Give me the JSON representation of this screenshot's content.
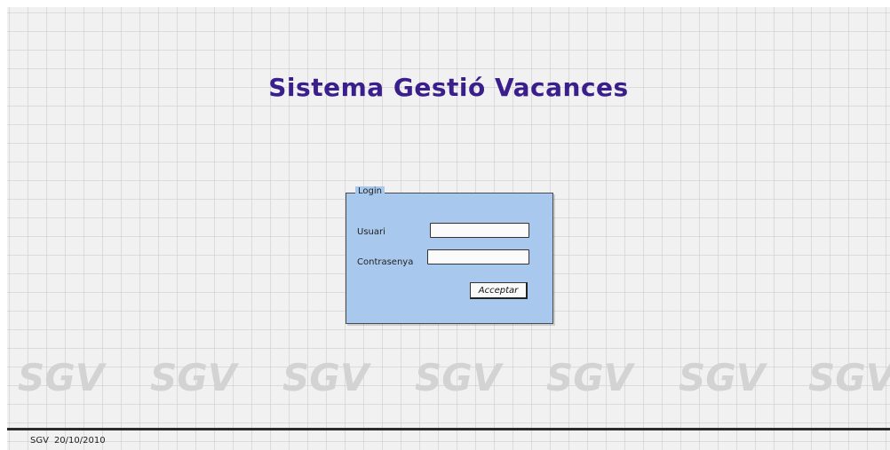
{
  "app": {
    "title": "Sistema Gestió Vacances"
  },
  "login": {
    "legend": "Login",
    "user_label": "Usuari",
    "user_value": "",
    "password_label": "Contrasenya",
    "password_value": "",
    "accept_label": "Acceptar"
  },
  "watermark": {
    "items": [
      "SGV",
      "SGV",
      "SGV",
      "SGV",
      "SGV",
      "SGV",
      "SGV"
    ]
  },
  "footer": {
    "app_code": "SGV",
    "date": "20/10/2010"
  },
  "colors": {
    "title": "#3a1e8c",
    "login_panel": "#a9c8ee",
    "watermark": "#d3d3d3",
    "background": "#f1f1f1"
  }
}
